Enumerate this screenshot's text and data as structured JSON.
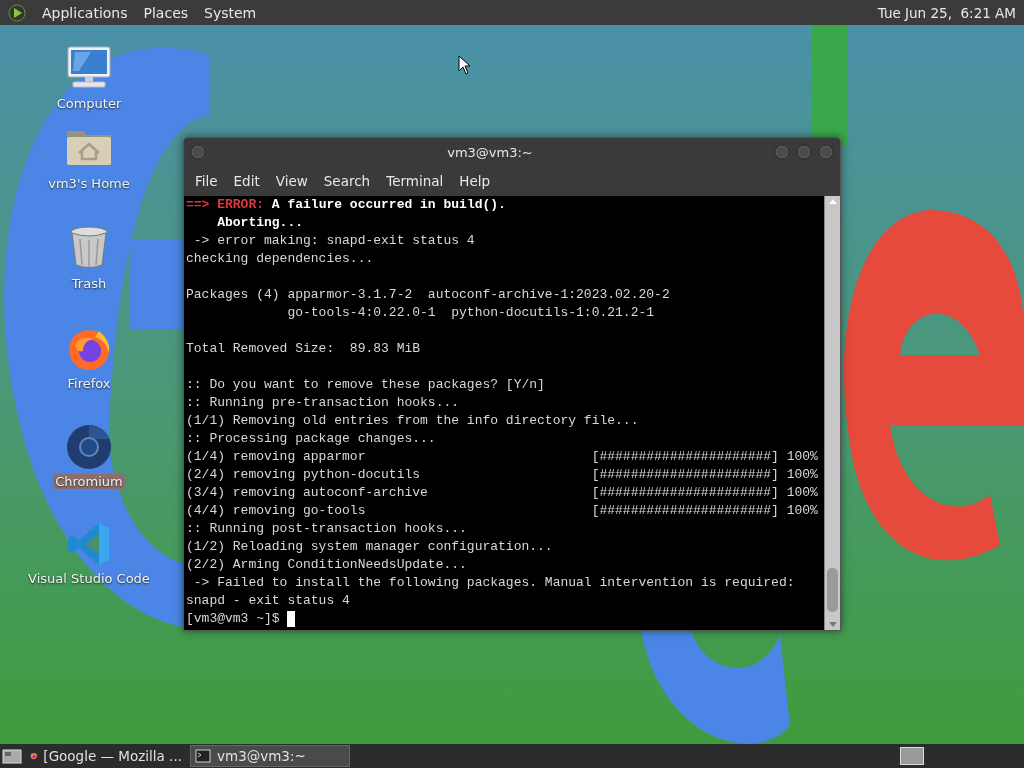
{
  "top_panel": {
    "menus": [
      "Applications",
      "Places",
      "System"
    ],
    "clock": "Tue Jun 25,  6:21 AM"
  },
  "desktop_icons": [
    {
      "kind": "computer",
      "label": "Computer",
      "selected": false
    },
    {
      "kind": "home",
      "label": "vm3's Home",
      "selected": false
    },
    {
      "kind": "trash",
      "label": "Trash",
      "selected": false
    },
    {
      "kind": "firefox",
      "label": "Firefox",
      "selected": false
    },
    {
      "kind": "chromium",
      "label": "Chromium",
      "selected": true
    },
    {
      "kind": "vscode",
      "label": "Visual Studio Code",
      "selected": false
    }
  ],
  "terminal": {
    "title": "vm3@vm3:~",
    "menu": [
      "File",
      "Edit",
      "View",
      "Search",
      "Terminal",
      "Help"
    ],
    "lines": [
      {
        "kind": "error",
        "arrow": "==>",
        "label": "ERROR:",
        "text": "A failure occurred in build()."
      },
      {
        "kind": "bold",
        "text": "    Aborting..."
      },
      {
        "kind": "plain",
        "text": " -> error making: snapd-exit status 4"
      },
      {
        "kind": "plain",
        "text": "checking dependencies..."
      },
      {
        "kind": "blank"
      },
      {
        "kind": "plain",
        "text": "Packages (4) apparmor-3.1.7-2  autoconf-archive-1:2023.02.20-2"
      },
      {
        "kind": "plain",
        "text": "             go-tools-4:0.22.0-1  python-docutils-1:0.21.2-1"
      },
      {
        "kind": "blank"
      },
      {
        "kind": "plain",
        "text": "Total Removed Size:  89.83 MiB"
      },
      {
        "kind": "blank"
      },
      {
        "kind": "plain",
        "text": ":: Do you want to remove these packages? [Y/n]"
      },
      {
        "kind": "plain",
        "text": ":: Running pre-transaction hooks..."
      },
      {
        "kind": "plain",
        "text": "(1/1) Removing old entries from the info directory file..."
      },
      {
        "kind": "plain",
        "text": ":: Processing package changes..."
      },
      {
        "kind": "progress",
        "text": "(1/4) removing apparmor",
        "bar": "[######################]",
        "percent": "100%"
      },
      {
        "kind": "progress",
        "text": "(2/4) removing python-docutils",
        "bar": "[######################]",
        "percent": "100%"
      },
      {
        "kind": "progress",
        "text": "(3/4) removing autoconf-archive",
        "bar": "[######################]",
        "percent": "100%"
      },
      {
        "kind": "progress",
        "text": "(4/4) removing go-tools",
        "bar": "[######################]",
        "percent": "100%"
      },
      {
        "kind": "plain",
        "text": ":: Running post-transaction hooks..."
      },
      {
        "kind": "plain",
        "text": "(1/2) Reloading system manager configuration..."
      },
      {
        "kind": "plain",
        "text": "(2/2) Arming ConditionNeedsUpdate..."
      },
      {
        "kind": "plain",
        "text": " -> Failed to install the following packages. Manual intervention is required:"
      },
      {
        "kind": "plain",
        "text": "snapd - exit status 4"
      },
      {
        "kind": "prompt",
        "text": "[vm3@vm3 ~]$"
      }
    ]
  },
  "taskbar": {
    "tasks": [
      {
        "kind": "firefox",
        "label": "[Google — Mozilla ...",
        "selected": false
      },
      {
        "kind": "terminal",
        "label": "vm3@vm3:~",
        "selected": true
      }
    ]
  }
}
